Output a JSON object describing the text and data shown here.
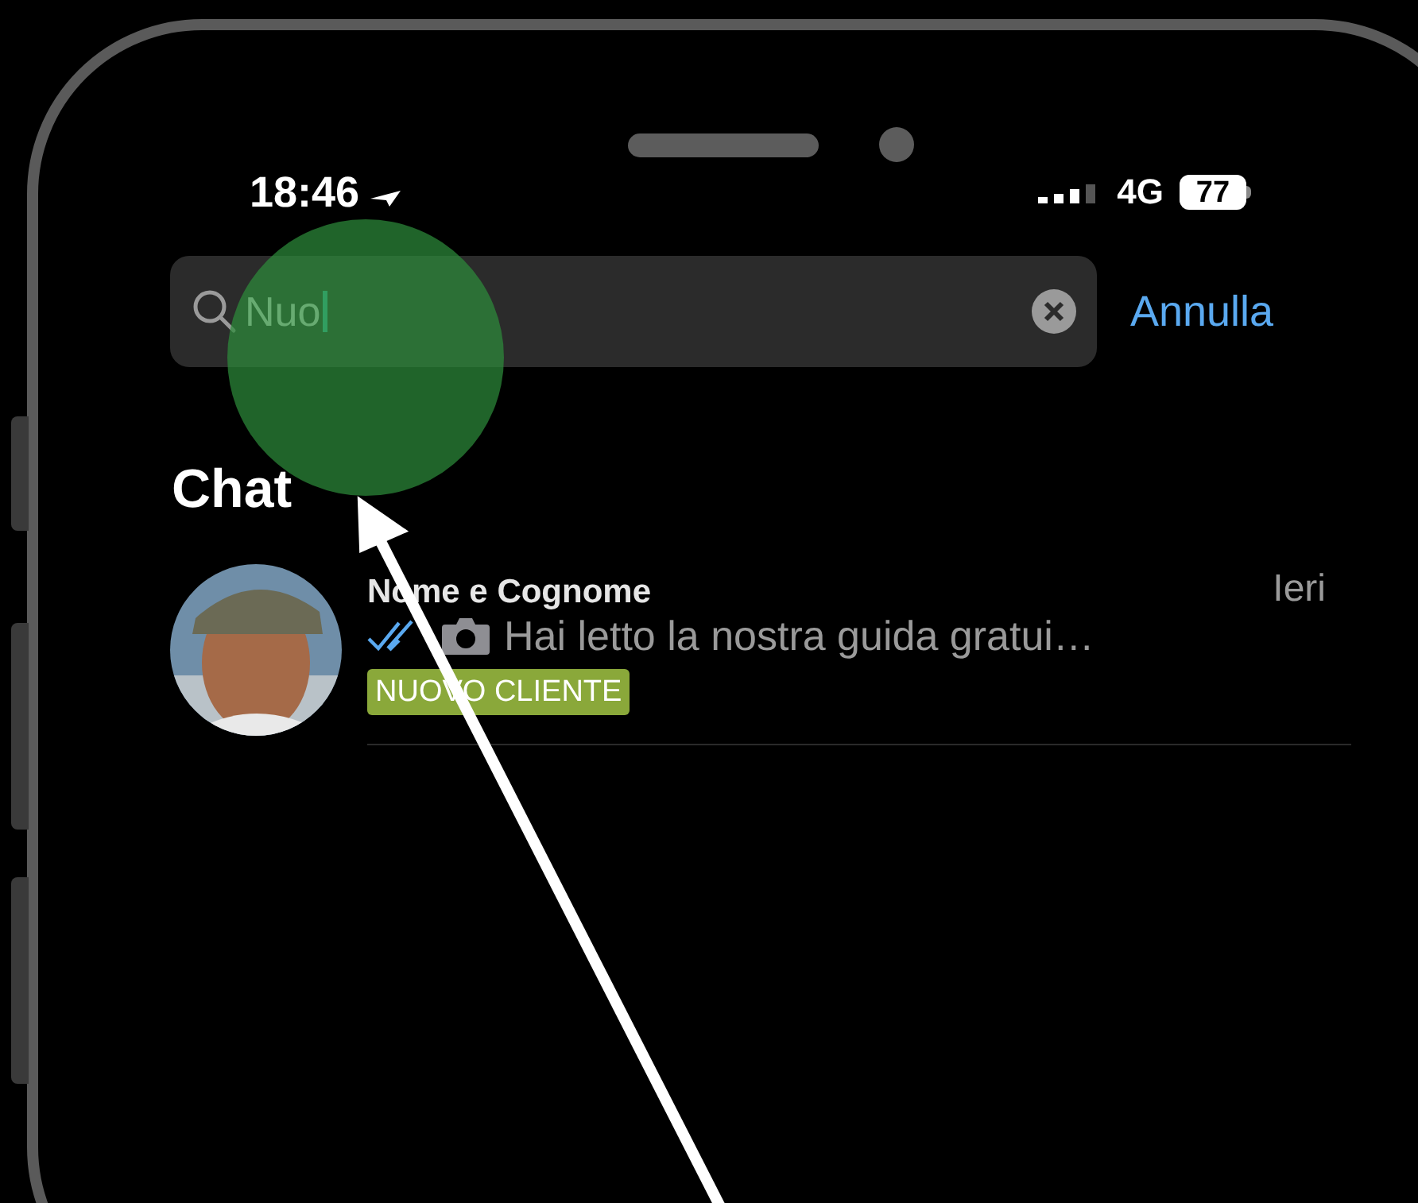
{
  "status_bar": {
    "time": "18:46",
    "network": "4G",
    "battery": "77"
  },
  "search": {
    "value": "Nuo"
  },
  "cancel_button": "Annulla",
  "section_title": "Chat",
  "chats": [
    {
      "name": "Nome e Cognome",
      "time": "Ieri",
      "preview": "Hai letto la nostra guida gratui…",
      "read": true,
      "tag": "NUOVO CLIENTE"
    }
  ]
}
